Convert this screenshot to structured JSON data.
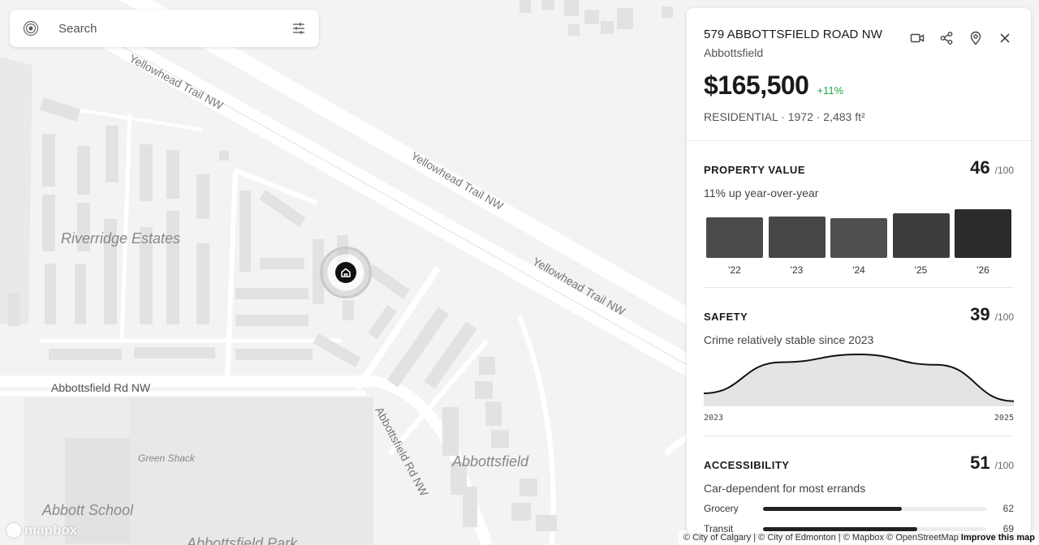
{
  "search": {
    "placeholder": "Search"
  },
  "map": {
    "labels": {
      "road1": "Yellowhead Trail NW",
      "road2": "Yellowhead Trail NW",
      "road3": "Yellowhead Trail NW",
      "riverridge": "Riverridge Estates",
      "abbottsfield_rd": "Abbottsfield Rd NW",
      "abbottsfield_rd2": "Abbottsfield Rd NW",
      "green_shack": "Green Shack",
      "abbottsfield": "Abbottsfield",
      "abbott_school": "Abbott School",
      "abbottsfield_park": "Abbottsfield Park"
    },
    "logo": "mapbox",
    "attribution": "© City of Calgary | © City of Edmonton | © Mapbox © OpenStreetMap",
    "improve": "Improve this map"
  },
  "property": {
    "address": "579 ABBOTTSFIELD ROAD NW",
    "neighbourhood": "Abbottsfield",
    "price": "$165,500",
    "change": "+11%",
    "meta": "RESIDENTIAL · 1972 · 2,483 ft²"
  },
  "value_section": {
    "title": "PROPERTY VALUE",
    "score": "46",
    "out_of": "/100",
    "subtitle": "11% up year-over-year"
  },
  "safety_section": {
    "title": "SAFETY",
    "score": "39",
    "out_of": "/100",
    "subtitle": "Crime relatively stable since 2023"
  },
  "accessibility_section": {
    "title": "ACCESSIBILITY",
    "score": "51",
    "out_of": "/100",
    "subtitle": "Car-dependent for most errands",
    "rows": [
      {
        "label": "Grocery",
        "value": "62",
        "fraction": 0.62
      },
      {
        "label": "Transit",
        "value": "69",
        "fraction": 0.69
      }
    ]
  },
  "chart_data": [
    {
      "type": "bar",
      "categories": [
        "'22",
        "'23",
        "'24",
        "'25",
        "'26"
      ],
      "values": [
        48,
        49,
        47,
        53,
        58
      ],
      "colors": [
        "#4a4a4a",
        "#474747",
        "#4f4f4f",
        "#3d3d3d",
        "#2b2b2b"
      ]
    },
    {
      "type": "area",
      "x": [
        2023,
        2023.5,
        2024,
        2024.5,
        2025
      ],
      "values": [
        0.25,
        0.85,
        1.0,
        0.8,
        0.1
      ],
      "x_tick_labels": [
        "2023",
        "2025"
      ]
    }
  ]
}
